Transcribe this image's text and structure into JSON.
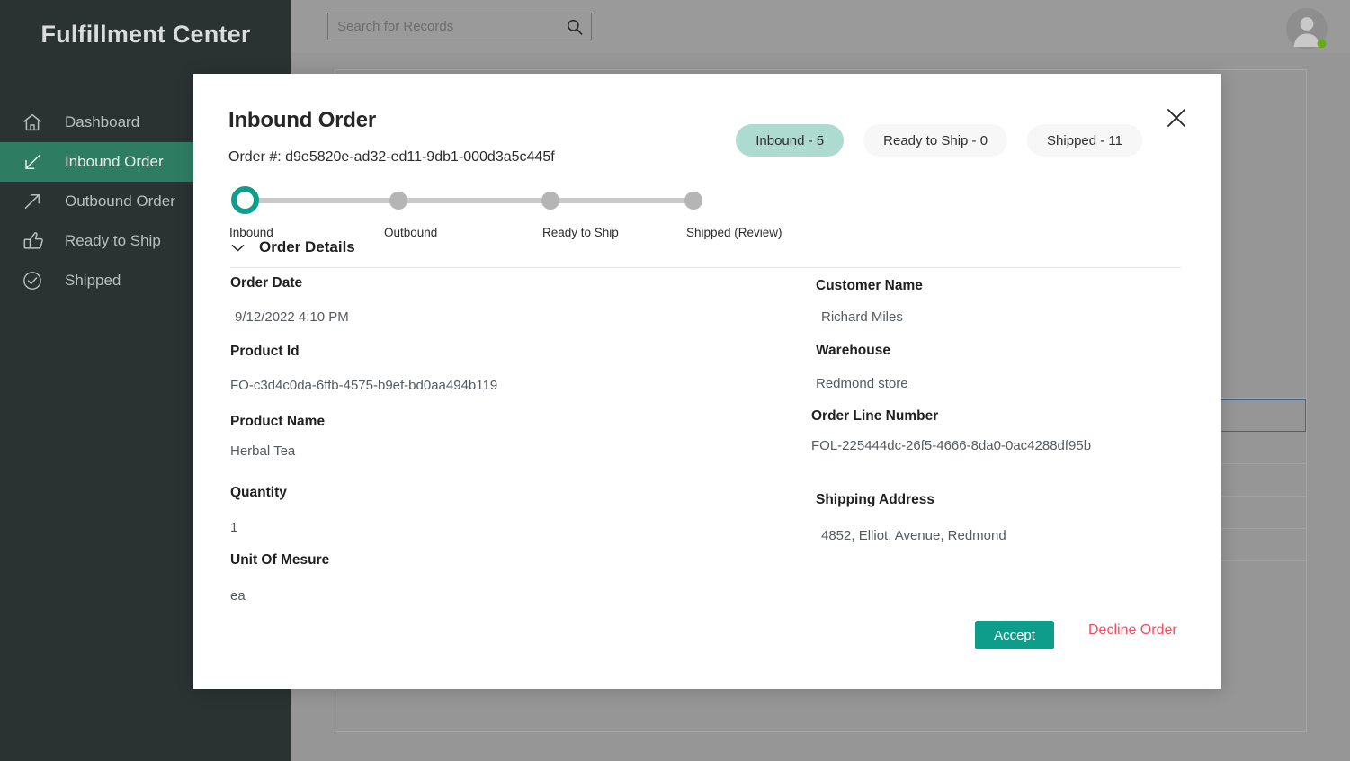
{
  "app": {
    "brand": "Fulfillment Center",
    "accent_teal": "#0e9d8b",
    "sidebar_active_green": "#2e7d63",
    "pill_active_mint": "#aedbd0",
    "decline_red": "#f9485b"
  },
  "sidebar": {
    "items": [
      {
        "label": "Dashboard",
        "icon": "home-icon",
        "active": false
      },
      {
        "label": "Inbound Order",
        "icon": "arrow-down-left-icon",
        "active": true
      },
      {
        "label": "Outbound Order",
        "icon": "arrow-up-right-icon",
        "active": false
      },
      {
        "label": "Ready to Ship",
        "icon": "thumbs-up-icon",
        "active": false
      },
      {
        "label": "Shipped",
        "icon": "check-circle-icon",
        "active": false
      }
    ]
  },
  "topbar": {
    "search_placeholder": "Search for Records",
    "search_value": "",
    "search_icon": "search-icon",
    "avatar_icon": "avatar-icon",
    "presence": "online"
  },
  "modal": {
    "title": "Inbound Order",
    "order_number_label": "Order #: d9e5820e-ad32-ed11-9db1-000d3a5c445f",
    "close_icon": "close-icon",
    "pills": [
      {
        "label": "Inbound - 5",
        "active": true
      },
      {
        "label": "Ready to Ship - 0",
        "active": false
      },
      {
        "label": "Shipped - 11",
        "active": false
      }
    ],
    "stepper": {
      "steps": [
        {
          "label": "Inbound",
          "state": "current"
        },
        {
          "label": "Outbound",
          "state": "pending"
        },
        {
          "label": "Ready to Ship",
          "state": "pending"
        },
        {
          "label": "Shipped (Review)",
          "state": "pending"
        }
      ]
    },
    "details": {
      "section_title": "Order Details",
      "chevron_icon": "chevron-down-icon",
      "left_fields": [
        {
          "label": "Order Date",
          "value": "9/12/2022 4:10 PM"
        },
        {
          "label": "Product Id",
          "value": "FO-c3d4c0da-6ffb-4575-b9ef-bd0aa494b119"
        },
        {
          "label": "Product Name",
          "value": "Herbal Tea"
        },
        {
          "label": "Quantity",
          "value": "1"
        },
        {
          "label": "Unit Of Mesure",
          "value": "ea"
        }
      ],
      "right_fields": [
        {
          "label": "Customer Name",
          "value": "Richard Miles"
        },
        {
          "label": "Warehouse",
          "value": "Redmond store"
        },
        {
          "label": "Order Line Number",
          "value": "FOL-225444dc-26f5-4666-8da0-0ac4288df95b"
        },
        {
          "label": "Shipping Address",
          "value": "4852, Elliot, Avenue, Redmond"
        }
      ]
    },
    "accept_label": "Accept",
    "decline_label": "Decline Order"
  }
}
